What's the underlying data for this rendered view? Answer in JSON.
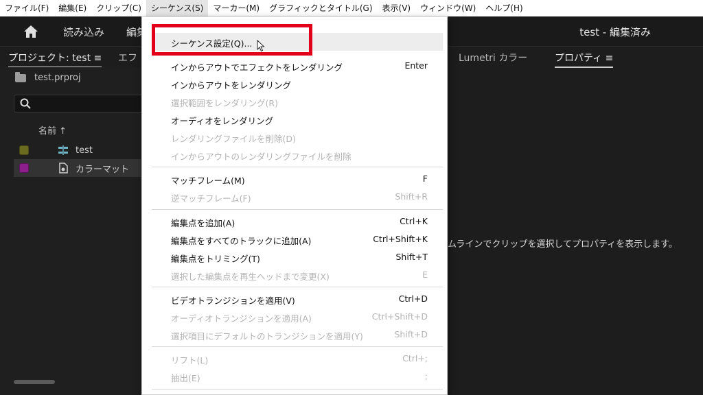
{
  "menubar": {
    "items": [
      {
        "label": "ファイル(F)"
      },
      {
        "label": "編集(E)"
      },
      {
        "label": "クリップ(C)"
      },
      {
        "label": "シーケンス(S)"
      },
      {
        "label": "マーカー(M)"
      },
      {
        "label": "グラフィックとタイトル(G)"
      },
      {
        "label": "表示(V)"
      },
      {
        "label": "ウィンドウ(W)"
      },
      {
        "label": "ヘルプ(H)"
      }
    ]
  },
  "header": {
    "tab_import": "読み込み",
    "tab_edit": "編集",
    "title": "test - 編集済み"
  },
  "panel_tabs": {
    "project": "プロジェクト: test",
    "effects": "エフ",
    "lumetri": "Lumetri カラー",
    "properties": "プロパティ"
  },
  "project": {
    "file": "test.prproj",
    "column_name": "名前 ↑",
    "items": [
      {
        "label": "test",
        "color": "#6b6b1f"
      },
      {
        "label": "カラーマット",
        "color": "#8c1f8c"
      }
    ]
  },
  "properties_message": "ムラインでクリップを選択してプロパティを表示します。",
  "dropdown": {
    "items": [
      {
        "label": "シーケンス設定(Q)...",
        "shortcut": ""
      },
      {
        "label": "インからアウトでエフェクトをレンダリング",
        "shortcut": "Enter"
      },
      {
        "label": "インからアウトをレンダリング",
        "shortcut": ""
      },
      {
        "label": "選択範囲をレンダリング(R)",
        "shortcut": ""
      },
      {
        "label": "オーディオをレンダリング",
        "shortcut": ""
      },
      {
        "label": "レンダリングファイルを削除(D)",
        "shortcut": ""
      },
      {
        "label": "インからアウトのレンダリングファイルを削除",
        "shortcut": ""
      },
      {
        "label": "マッチフレーム(M)",
        "shortcut": "F"
      },
      {
        "label": "逆マッチフレーム(F)",
        "shortcut": "Shift+R"
      },
      {
        "label": "編集点を追加(A)",
        "shortcut": "Ctrl+K"
      },
      {
        "label": "編集点をすべてのトラックに追加(A)",
        "shortcut": "Ctrl+Shift+K"
      },
      {
        "label": "編集点をトリミング(T)",
        "shortcut": "Shift+T"
      },
      {
        "label": "選択した編集点を再生ヘッドまで変更(X)",
        "shortcut": "E"
      },
      {
        "label": "ビデオトランジションを適用(V)",
        "shortcut": "Ctrl+D"
      },
      {
        "label": "オーディオトランジションを適用(A)",
        "shortcut": "Ctrl+Shift+D"
      },
      {
        "label": "選択項目にデフォルトのトランジションを適用(Y)",
        "shortcut": "Shift+D"
      },
      {
        "label": "リフト(L)",
        "shortcut": "Ctrl+;"
      },
      {
        "label": "抽出(E)",
        "shortcut": ";"
      }
    ]
  },
  "colors": {
    "highlight": "#e3001b",
    "disabled_text": "#b3b3b3"
  }
}
